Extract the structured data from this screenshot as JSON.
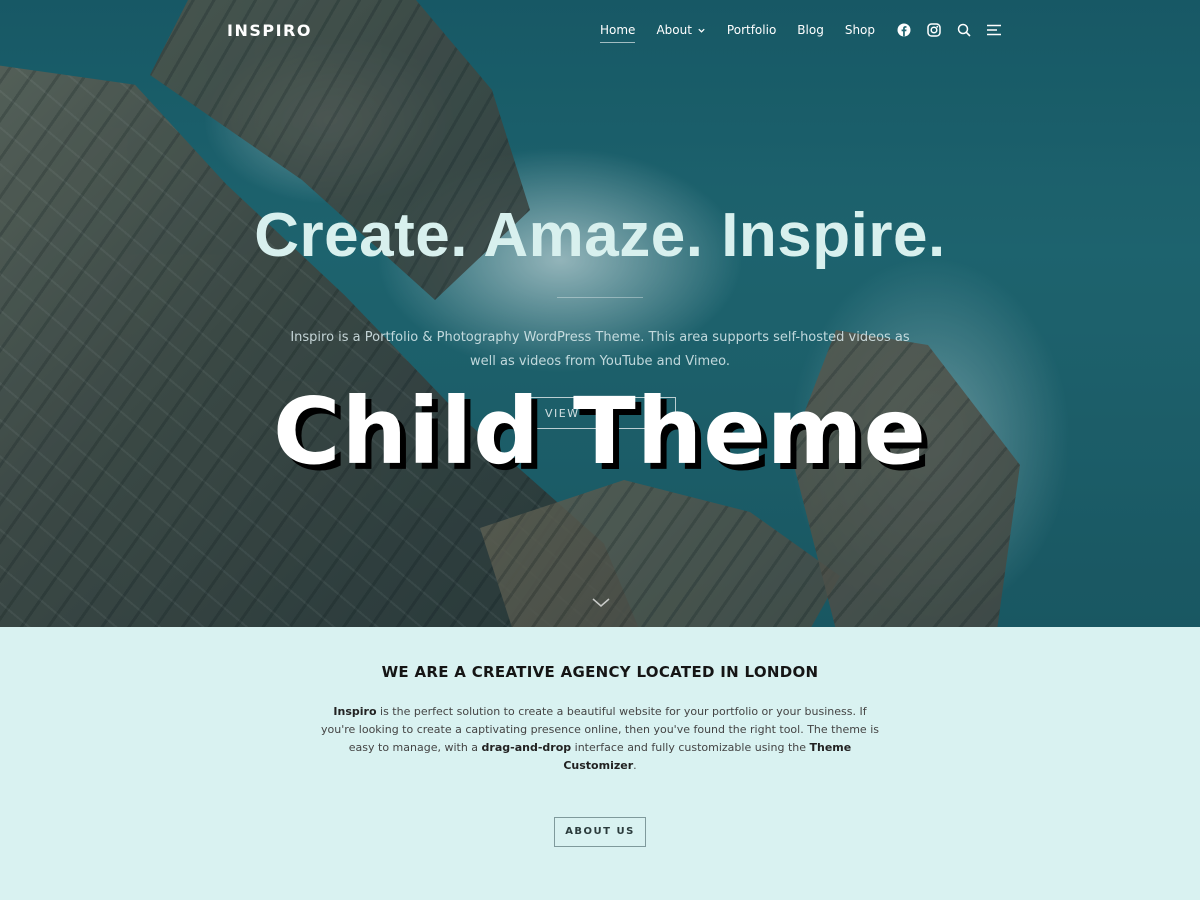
{
  "header": {
    "logo": "INSPIRO",
    "nav": [
      {
        "label": "Home"
      },
      {
        "label": "About"
      },
      {
        "label": "Portfolio"
      },
      {
        "label": "Blog"
      },
      {
        "label": "Shop"
      }
    ],
    "icons": [
      "facebook-icon",
      "instagram-icon",
      "search-icon",
      "menu-icon"
    ]
  },
  "hero": {
    "title": "Create. Amaze. Inspire.",
    "description": "Inspiro is a Portfolio & Photography WordPress Theme. This area supports self-hosted videos as well as videos from YouTube and Vimeo.",
    "button": "VIEW",
    "overlay_label": "Child Theme"
  },
  "about": {
    "title": "WE ARE A CREATIVE AGENCY LOCATED IN LONDON",
    "text": {
      "part1_bold": "Inspiro",
      "part2": " is the perfect solution to create a beautiful website for your portfolio or your business. If you're looking to create a captivating presence online, then you've found the right tool. The theme is easy to manage, with a ",
      "part3_bold": "drag-and-drop",
      "part4": " interface and fully customizable using the ",
      "part5_bold": "Theme Customizer",
      "part6": "."
    },
    "button": "ABOUT US"
  },
  "colors": {
    "about_bg": "#d9f2f1",
    "hero_text": "#d8f0ee"
  }
}
